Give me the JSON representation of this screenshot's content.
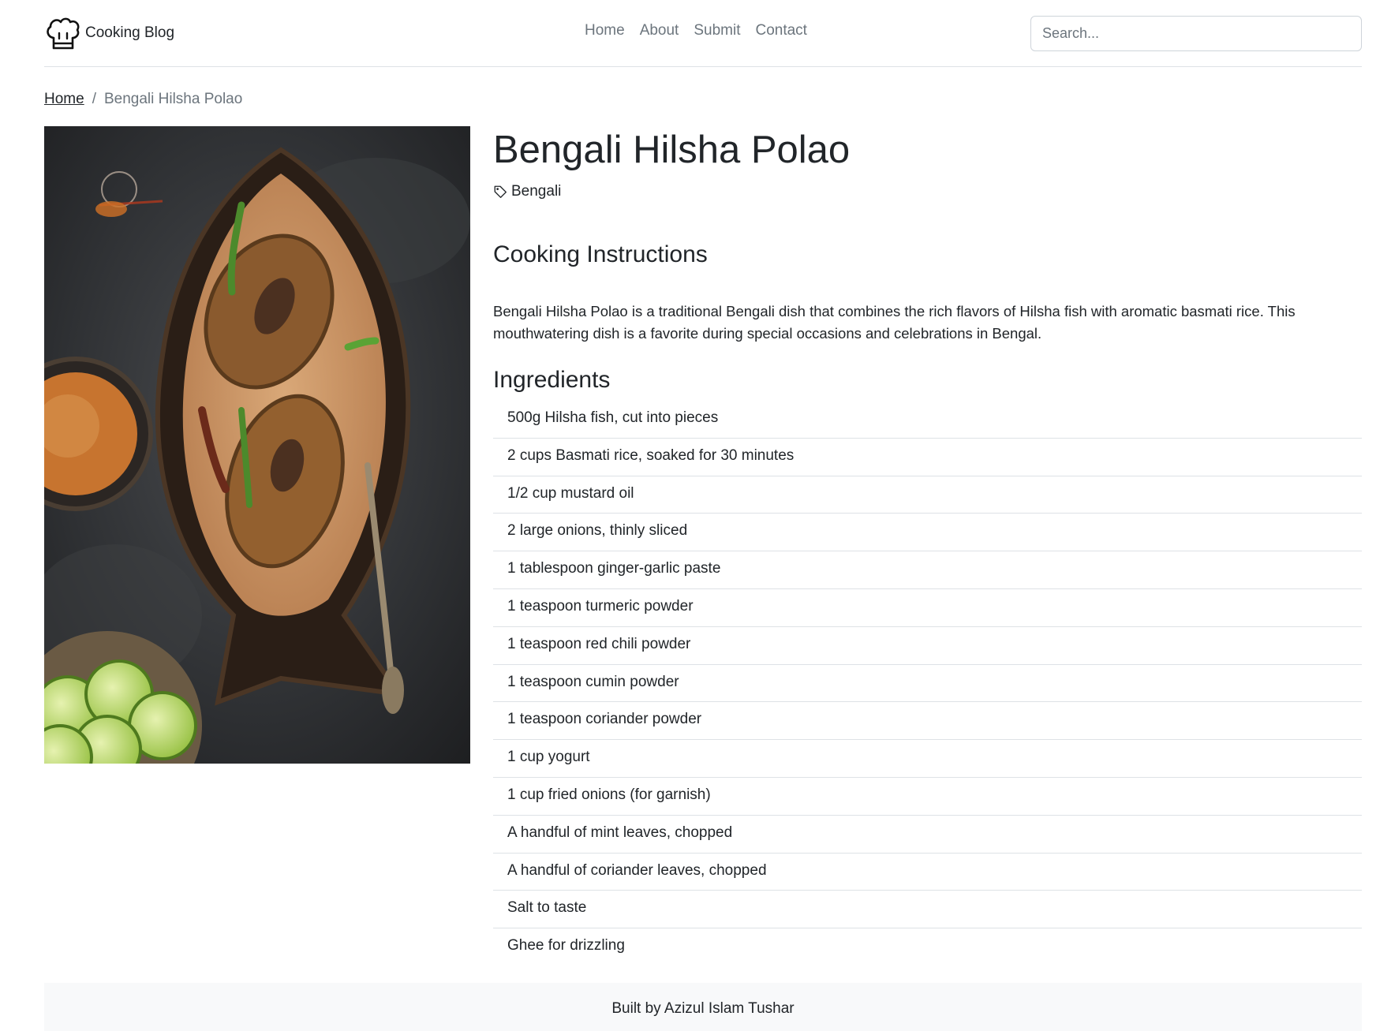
{
  "header": {
    "brand": "Cooking Blog",
    "nav": [
      "Home",
      "About",
      "Submit",
      "Contact"
    ],
    "search_placeholder": "Search..."
  },
  "breadcrumb": {
    "home": "Home",
    "separator": "/",
    "current": "Bengali Hilsha Polao"
  },
  "recipe": {
    "title": "Bengali Hilsha Polao",
    "tag": "Bengali",
    "tag_icon": "tag-icon",
    "image_alt": "Bengali Hilsha Polao dish",
    "instructions_heading": "Cooking Instructions",
    "description": "Bengali Hilsha Polao is a traditional Bengali dish that combines the rich flavors of Hilsha fish with aromatic basmati rice. This mouthwatering dish is a favorite during special occasions and celebrations in Bengal.",
    "ingredients_heading": "Ingredients",
    "ingredients": [
      "500g Hilsha fish, cut into pieces",
      "2 cups Basmati rice, soaked for 30 minutes",
      "1/2 cup mustard oil",
      "2 large onions, thinly sliced",
      "1 tablespoon ginger-garlic paste",
      "1 teaspoon turmeric powder",
      "1 teaspoon red chili powder",
      "1 teaspoon cumin powder",
      "1 teaspoon coriander powder",
      "1 cup yogurt",
      "1 cup fried onions (for garnish)",
      "A handful of mint leaves, chopped",
      "A handful of coriander leaves, chopped",
      "Salt to taste",
      "Ghee for drizzling"
    ]
  },
  "footer": {
    "text": "Built by Azizul Islam Tushar"
  }
}
